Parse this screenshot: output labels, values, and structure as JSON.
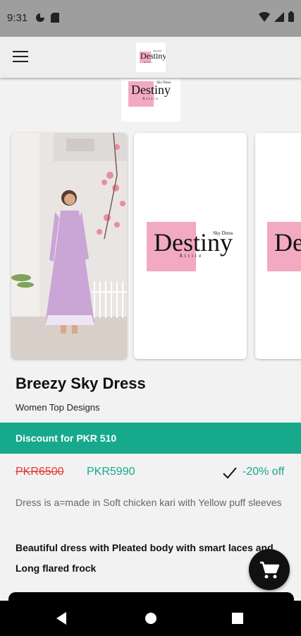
{
  "status_bar": {
    "time": "9:31",
    "icons": [
      "data-saver-icon",
      "sim-card-icon",
      "wifi-icon",
      "signal-icon",
      "battery-icon"
    ]
  },
  "app_bar": {
    "menu_icon": "hamburger-menu-icon",
    "logo": {
      "name": "Destiny",
      "tagline": "Sky Dress",
      "subtext": "Attire"
    }
  },
  "brand_logo": {
    "name": "Destiny",
    "tagline": "Sky Dress",
    "subtext": "Attire"
  },
  "gallery": {
    "logo": {
      "name": "Destiny",
      "tagline": "Sky Dress",
      "subtext": "Attire"
    },
    "partial_logo_text": "De"
  },
  "product": {
    "title": "Breezy Sky Dress",
    "category": "Women Top Designs",
    "discount_banner": "Discount for PKR 510",
    "price_original": "PKR6500",
    "price_discounted": "PKR5990",
    "discount_percent": "-20% off",
    "description": "Dress is a=made in Soft chicken kari with Yellow puff sleeves",
    "details_line1": "Beautiful dress with Pleated body with smart laces and",
    "details_line2": "Long flared frock"
  },
  "colors": {
    "accent": "#17a98c",
    "price_red": "#e53935",
    "logo_pink": "#f2a9c2",
    "status_bar": "#9e9e9e"
  },
  "fab": {
    "icon": "shopping-cart-icon"
  },
  "nav": {
    "icons": [
      "back-icon",
      "home-icon",
      "recents-icon"
    ]
  }
}
